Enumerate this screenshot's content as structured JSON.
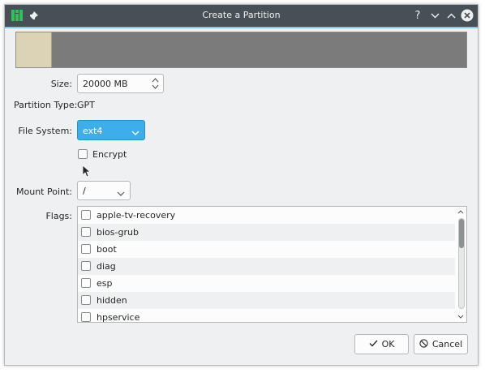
{
  "window": {
    "title": "Create a Partition",
    "buttons": {
      "help": "?",
      "minimize": "⌄",
      "maximize": "⌃",
      "close": "✕"
    }
  },
  "form": {
    "size_label": "Size:",
    "size_value": "20000 MB",
    "partition_type_label": "Partition Type:",
    "partition_type_value": "GPT",
    "filesystem_label": "File System:",
    "filesystem_value": "ext4",
    "encrypt_label": "Encrypt",
    "mount_label": "Mount Point:",
    "mount_value": "/",
    "flags_label": "Flags:"
  },
  "flags": [
    "apple-tv-recovery",
    "bios-grub",
    "boot",
    "diag",
    "esp",
    "hidden",
    "hpservice"
  ],
  "footer": {
    "ok_label": "OK",
    "cancel_label": "Cancel"
  },
  "colors": {
    "titlebar": "#475057",
    "accent": "#3daee9",
    "used_partition": "#dcd3b6",
    "free_space": "#7b7b7b"
  }
}
